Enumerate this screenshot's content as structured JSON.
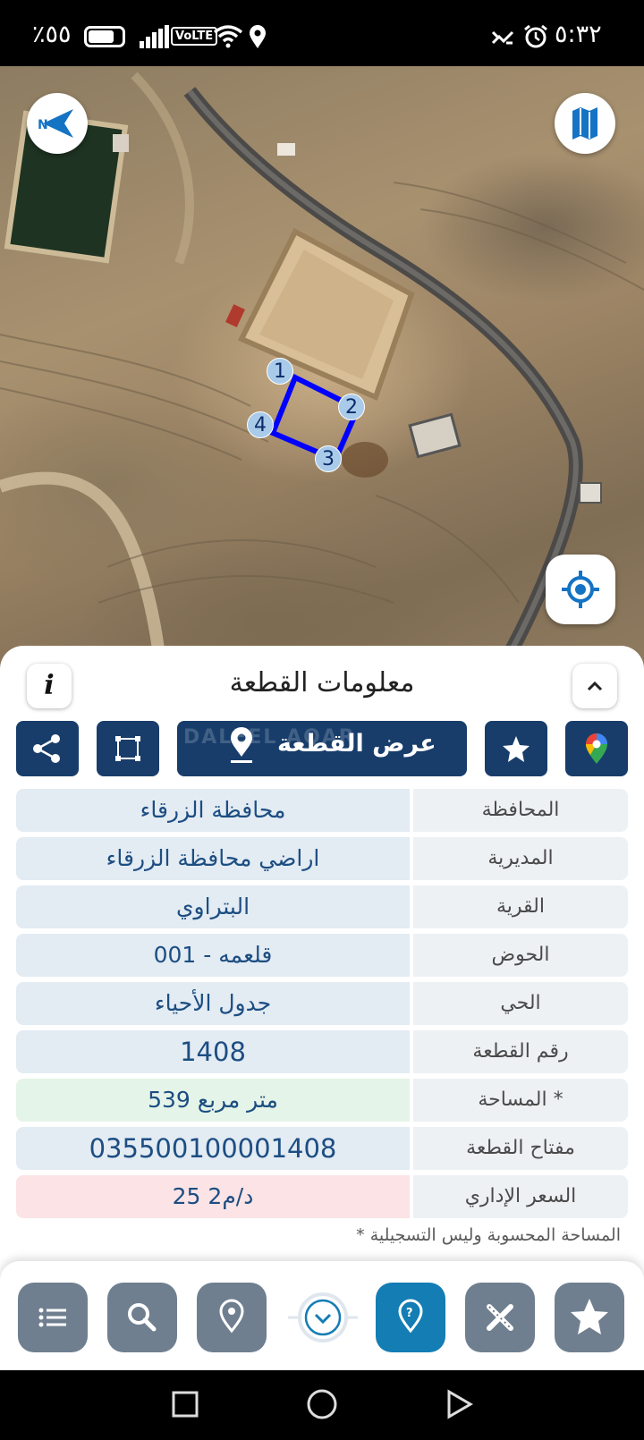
{
  "status_bar": {
    "battery_text": "٪٥٥",
    "network_badge": "VoLTE",
    "time": "٥:٣٢"
  },
  "map": {
    "plot_markers": [
      "1",
      "2",
      "3",
      "4"
    ],
    "outline_color": "#0000ff",
    "compass_icon": "north-arrow-icon",
    "map_view_icon": "map-icon",
    "gps_icon": "target-icon"
  },
  "sheet": {
    "title": "معلومات القطعة",
    "info_label": "i",
    "actions": {
      "show_plot_label": "عرض القطعة",
      "watermark": "DALEEL AQAR"
    },
    "rows": [
      {
        "label": "المحافظة",
        "value": "محافظة الزرقاء"
      },
      {
        "label": "المديرية",
        "value": "اراضي محافظة الزرقاء"
      },
      {
        "label": "القرية",
        "value": "البتراوي"
      },
      {
        "label": "الحوض",
        "value": "قلعمه - 001"
      },
      {
        "label": "الحي",
        "value": "جدول الأحياء"
      },
      {
        "label": "رقم القطعة",
        "value": "1408"
      },
      {
        "label": "المساحة *",
        "value": "539  متر مربع"
      },
      {
        "label": "مفتاح القطعة",
        "value": "035500100001408"
      },
      {
        "label": "السعر الإداري",
        "value": "25 د/م2"
      }
    ],
    "footnote": "* المساحة المحسوبة وليس التسجيلية"
  },
  "colors": {
    "primary": "#183d6b",
    "value_text": "#1c4e82",
    "area_bg": "#e5f4e8",
    "price_bg": "#fbe3e6",
    "toolbar_gray": "#6f7f90",
    "toolbar_active": "#137db4"
  }
}
